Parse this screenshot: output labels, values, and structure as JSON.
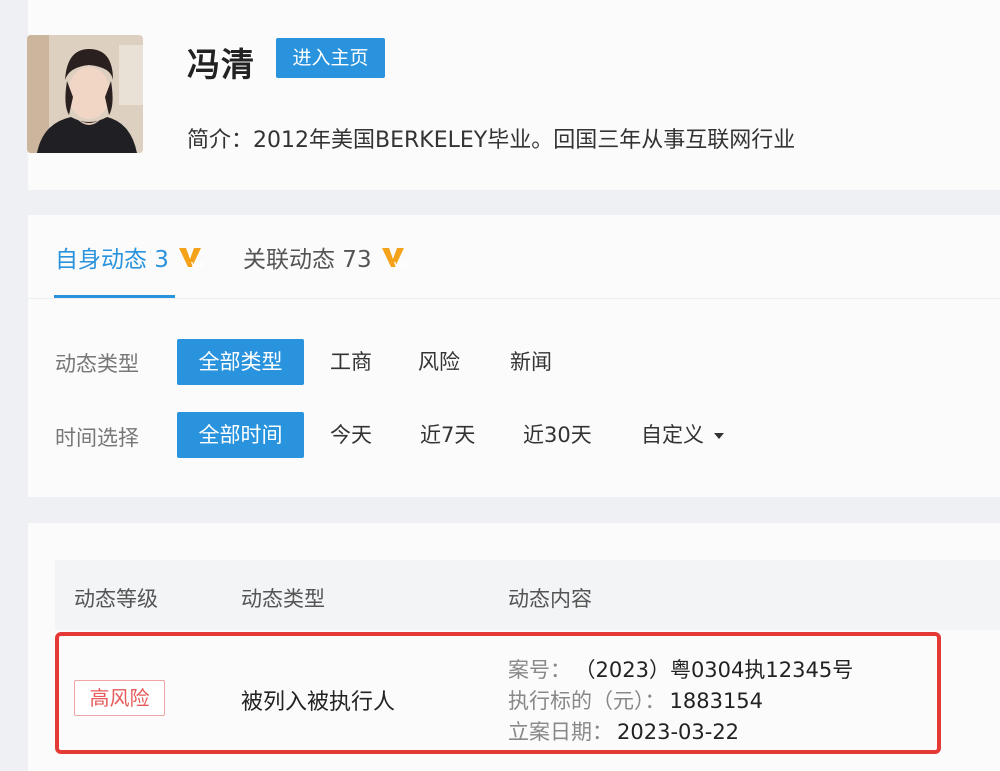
{
  "profile": {
    "name": "冯清",
    "home_button": "进入主页",
    "intro": "简介：2012年美国BERKELEY毕业。回国三年从事互联网行业"
  },
  "tabs": [
    {
      "label": "自身动态 3",
      "vip": "VIP",
      "active": true
    },
    {
      "label": "关联动态 73",
      "vip": "VIP",
      "active": false
    }
  ],
  "filters": {
    "type": {
      "label": "动态类型",
      "options": [
        "全部类型",
        "工商",
        "风险",
        "新闻"
      ],
      "selected": "全部类型"
    },
    "time": {
      "label": "时间选择",
      "options": [
        "全部时间",
        "今天",
        "近7天",
        "近30天",
        "自定义"
      ],
      "selected": "全部时间"
    }
  },
  "table": {
    "headers": [
      "动态等级",
      "动态类型",
      "动态内容"
    ],
    "rows": [
      {
        "level": "高风险",
        "type": "被列入被执行人",
        "content": [
          {
            "key": "案号：",
            "value": "（2023）粤0304执12345号"
          },
          {
            "key": "执行标的（元）：",
            "value": "1883154"
          },
          {
            "key": "立案日期：",
            "value": "2023-03-22"
          }
        ]
      }
    ]
  },
  "colors": {
    "accent": "#2a93dd",
    "risk_high": "#e65a5a",
    "highlight_border": "#e53935",
    "vip_orange": "#f5a21b"
  }
}
